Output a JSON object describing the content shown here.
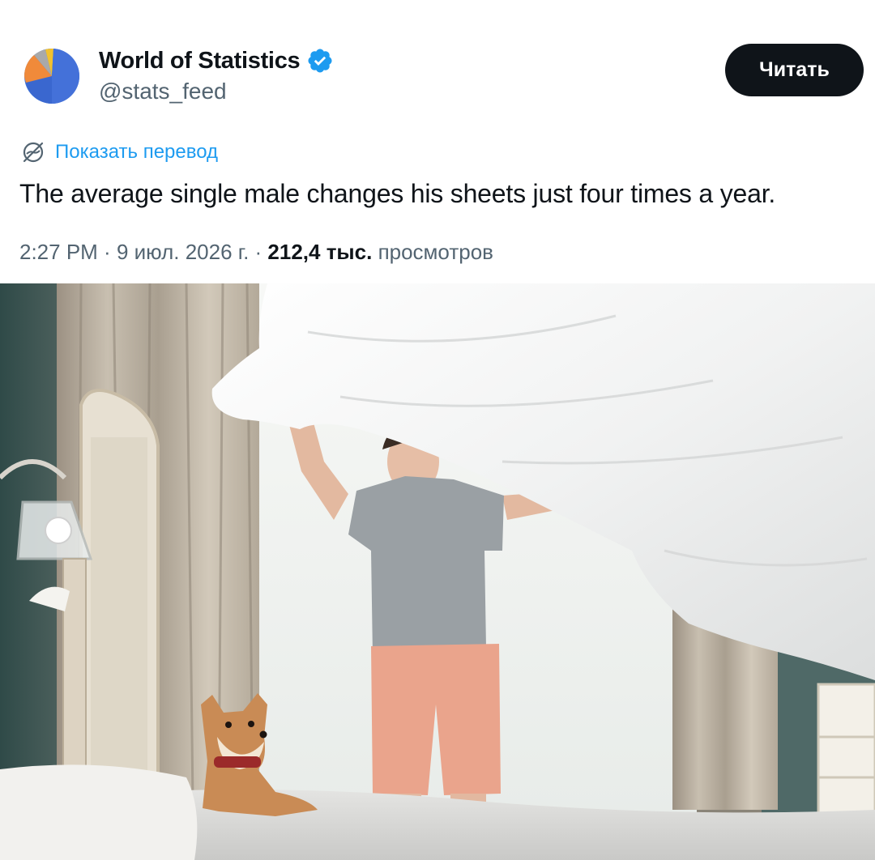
{
  "author": {
    "display_name": "World of Statistics",
    "handle": "@stats_feed",
    "avatar_icon": "pie-chart-icon",
    "verified_icon": "verified-badge-icon"
  },
  "follow_button": {
    "label": "Читать"
  },
  "translate": {
    "icon": "globe-slash-icon",
    "label": "Показать перевод"
  },
  "tweet": {
    "text": "The average single male changes his sheets just four times a year."
  },
  "meta": {
    "time": "2:27 PM",
    "date": "9 июл. 2026 г.",
    "separator": " · ",
    "views_count": "212,4 тыс.",
    "views_label": "просмотров"
  },
  "colors": {
    "accent": "#1d9bf0",
    "button_bg": "#0f1419",
    "text_primary": "#0f1419",
    "text_secondary": "#536471"
  }
}
